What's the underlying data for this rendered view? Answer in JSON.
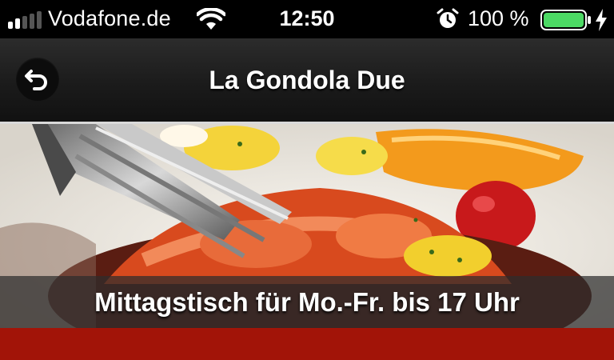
{
  "status_bar": {
    "carrier": "Vodafone.de",
    "time": "12:50",
    "battery_percent": "100 %",
    "battery_level": 1.0,
    "signal_bars": 2,
    "icons": [
      "signal-icon",
      "wifi-icon",
      "alarm-icon",
      "battery-icon",
      "charging-icon"
    ]
  },
  "nav": {
    "title": "La Gondola Due",
    "back_icon": "back-arrow-icon"
  },
  "hero": {
    "image": "lobster-dish-photo",
    "caption": "Mittagstisch für Mo.-Fr. bis 17 Uhr"
  },
  "colors": {
    "accent_red": "#a21408",
    "battery_green": "#4cd964"
  }
}
